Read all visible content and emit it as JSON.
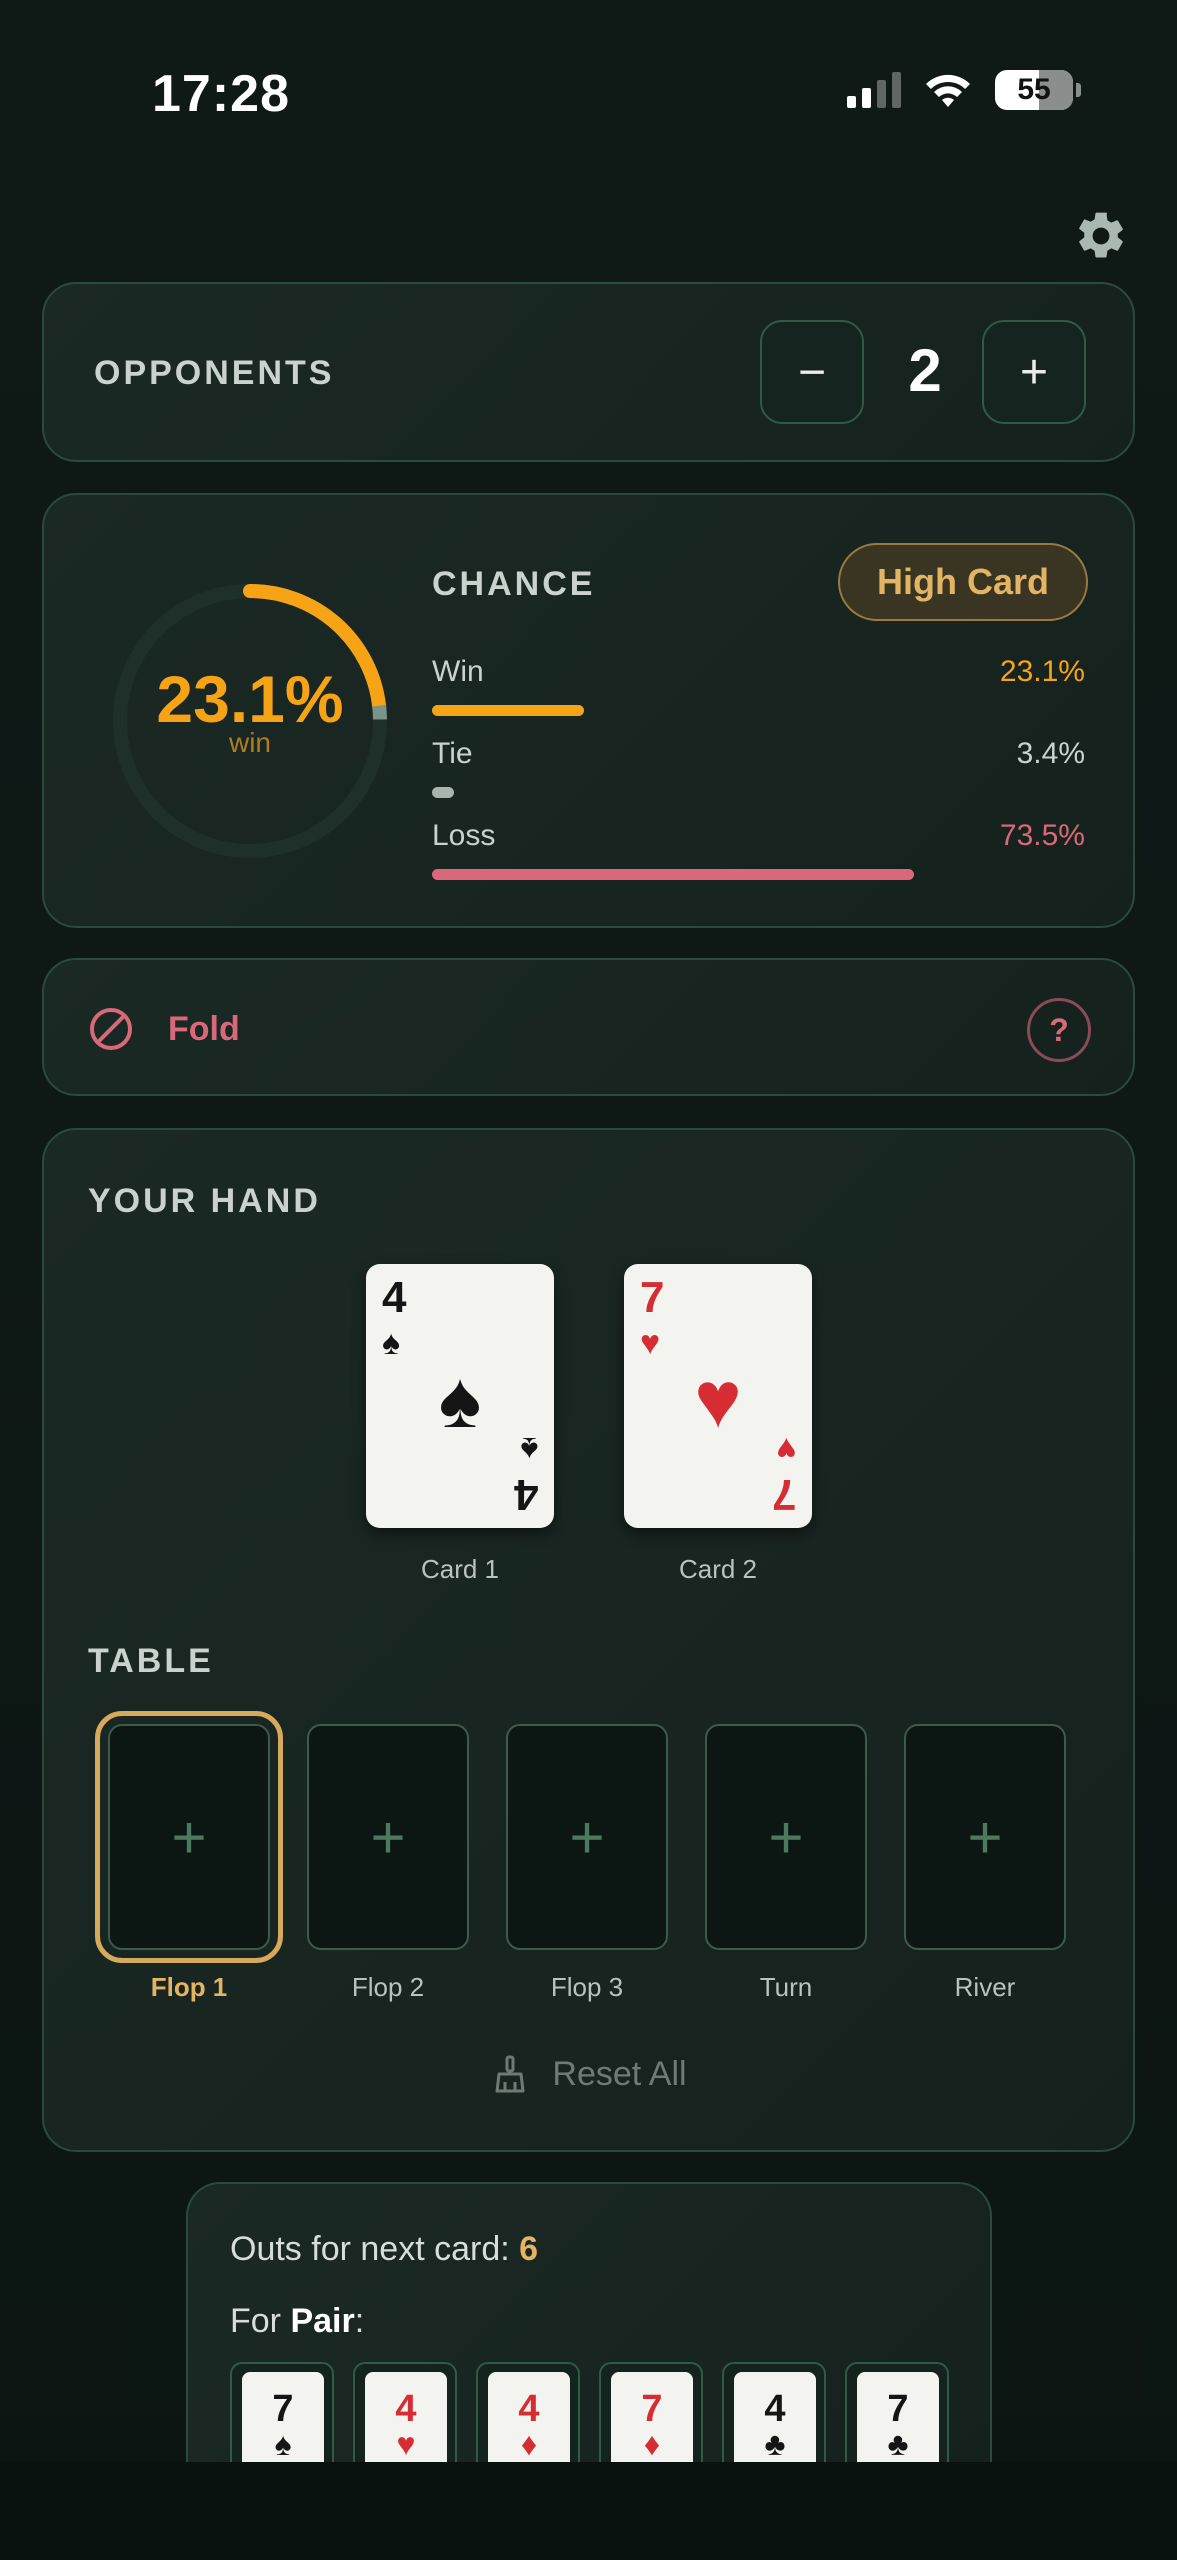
{
  "status": {
    "time": "17:28",
    "battery": "55"
  },
  "opponents": {
    "label": "OPPONENTS",
    "count": "2",
    "minus": "−",
    "plus": "+"
  },
  "chance": {
    "title": "CHANCE",
    "hand_rank": "High Card",
    "win_pct_big": "23.1%",
    "win_sub": "win",
    "stats": [
      {
        "label": "Win",
        "value": "23.1%",
        "fraction": 0.231,
        "color": "#f6a416"
      },
      {
        "label": "Tie",
        "value": "3.4%",
        "fraction": 0.034,
        "color": "#a8b4ae"
      },
      {
        "label": "Loss",
        "value": "73.5%",
        "fraction": 0.735,
        "color": "#d9687a"
      }
    ],
    "ring_fraction": 0.231
  },
  "advice": {
    "label": "Fold",
    "help": "?"
  },
  "hand": {
    "title": "YOUR HAND",
    "cards": [
      {
        "rank": "4",
        "suit": "♠",
        "color": "black",
        "caption": "Card 1"
      },
      {
        "rank": "7",
        "suit": "♥",
        "color": "red",
        "caption": "Card 2"
      }
    ]
  },
  "table": {
    "title": "TABLE",
    "slots": [
      {
        "caption": "Flop 1",
        "plus": "+"
      },
      {
        "caption": "Flop 2",
        "plus": "+"
      },
      {
        "caption": "Flop 3",
        "plus": "+"
      },
      {
        "caption": "Turn",
        "plus": "+"
      },
      {
        "caption": "River",
        "plus": "+"
      }
    ],
    "reset_label": "Reset All"
  },
  "outs": {
    "prefix": "Outs for next card: ",
    "count": "6",
    "for_prefix": "For ",
    "for_hand": "Pair",
    "for_suffix": ":",
    "cards": [
      {
        "rank": "7",
        "suit": "♠",
        "color": "black"
      },
      {
        "rank": "4",
        "suit": "♥",
        "color": "red"
      },
      {
        "rank": "4",
        "suit": "♦",
        "color": "red"
      },
      {
        "rank": "7",
        "suit": "♦",
        "color": "red"
      },
      {
        "rank": "4",
        "suit": "♣",
        "color": "black"
      },
      {
        "rank": "7",
        "suit": "♣",
        "color": "black"
      }
    ]
  }
}
